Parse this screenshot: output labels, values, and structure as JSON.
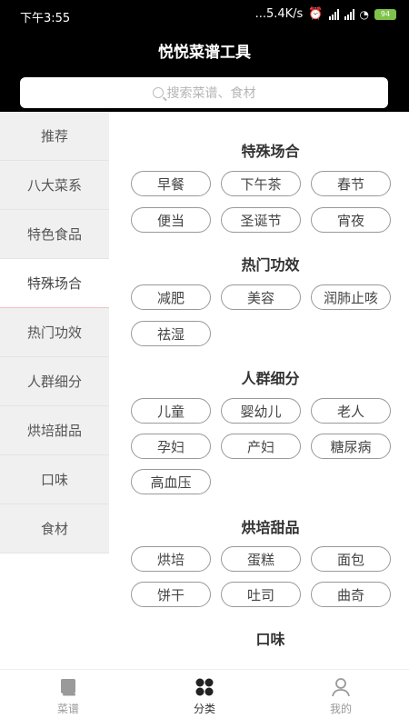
{
  "status": {
    "time": "下午3:55",
    "network": "...5.4K/s",
    "battery": "94"
  },
  "app": {
    "title": "悦悦菜谱工具"
  },
  "search": {
    "placeholder": "搜索菜谱、食材"
  },
  "sidebar": {
    "items": [
      {
        "label": "推荐"
      },
      {
        "label": "八大菜系"
      },
      {
        "label": "特色食品"
      },
      {
        "label": "特殊场合"
      },
      {
        "label": "热门功效"
      },
      {
        "label": "人群细分"
      },
      {
        "label": "烘培甜品"
      },
      {
        "label": "口味"
      },
      {
        "label": "食材"
      }
    ],
    "active_index": 3
  },
  "sections": [
    {
      "title": "特殊场合",
      "tags": [
        "早餐",
        "下午茶",
        "春节",
        "便当",
        "圣诞节",
        "宵夜"
      ]
    },
    {
      "title": "热门功效",
      "tags": [
        "减肥",
        "美容",
        "润肺止咳",
        "祛湿"
      ]
    },
    {
      "title": "人群细分",
      "tags": [
        "儿童",
        "婴幼儿",
        "老人",
        "孕妇",
        "产妇",
        "糖尿病",
        "高血压"
      ]
    },
    {
      "title": "烘培甜品",
      "tags": [
        "烘培",
        "蛋糕",
        "面包",
        "饼干",
        "吐司",
        "曲奇"
      ]
    },
    {
      "title": "口味",
      "tags": []
    }
  ],
  "bottom_nav": {
    "tabs": [
      {
        "label": "菜谱",
        "icon": "book-icon"
      },
      {
        "label": "分类",
        "icon": "category-icon"
      },
      {
        "label": "我的",
        "icon": "user-icon"
      }
    ],
    "active_index": 1
  }
}
